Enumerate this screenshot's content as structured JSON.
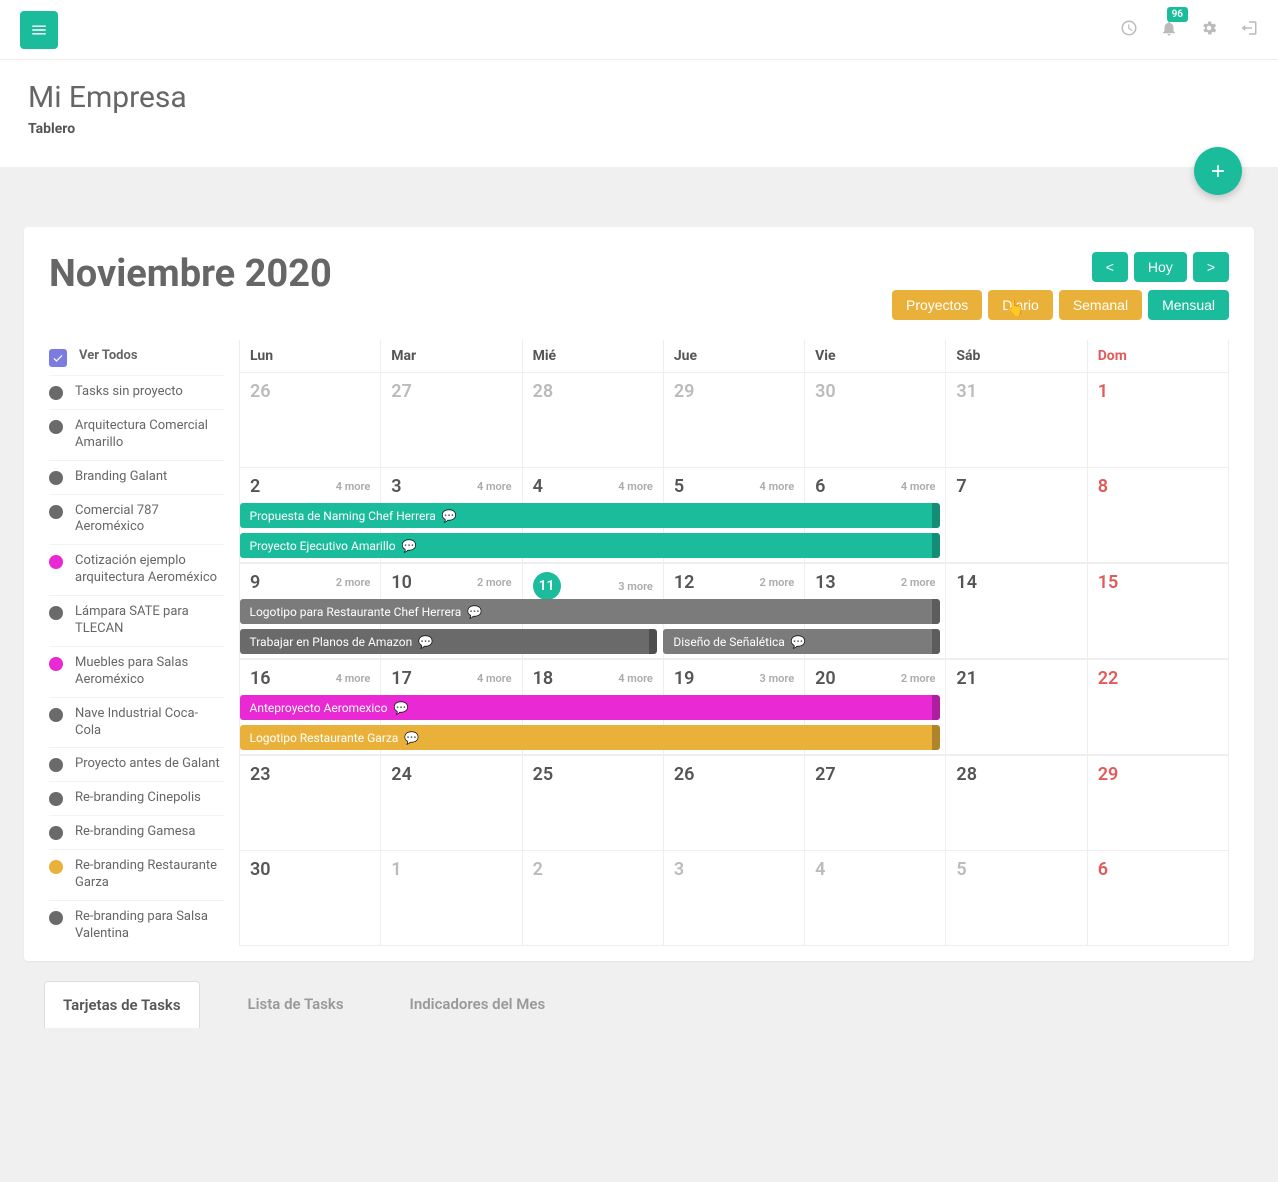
{
  "topbar": {
    "badge": "96"
  },
  "header": {
    "title": "Mi Empresa",
    "subtitle": "Tablero"
  },
  "calendar": {
    "title": "Noviembre 2020",
    "nav": {
      "prev": "<",
      "today": "Hoy",
      "next": ">"
    },
    "views": {
      "projects": "Proyectos",
      "daily": "Diario",
      "weekly": "Semanal",
      "monthly": "Mensual"
    },
    "days": [
      "Lun",
      "Mar",
      "Mié",
      "Jue",
      "Vie",
      "Sáb",
      "Dom"
    ]
  },
  "filters": {
    "all": "Ver Todos",
    "items": [
      {
        "label": "Tasks sin proyecto",
        "color": "#6a6a6a"
      },
      {
        "label": "Arquitectura Comercial Amarillo",
        "color": "#6a6a6a"
      },
      {
        "label": "Branding Galant",
        "color": "#6a6a6a"
      },
      {
        "label": "Comercial 787 Aeroméxico",
        "color": "#6a6a6a"
      },
      {
        "label": "Cotización ejemplo arquitectura Aeroméxico",
        "color": "#e929d3"
      },
      {
        "label": "Lámpara SATE para TLECAN",
        "color": "#6a6a6a"
      },
      {
        "label": "Muebles para Salas Aeroméxico",
        "color": "#e929d3"
      },
      {
        "label": "Nave Industrial Coca-Cola",
        "color": "#6a6a6a"
      },
      {
        "label": "Proyecto antes de Galant",
        "color": "#6a6a6a"
      },
      {
        "label": "Re-branding Cinepolis",
        "color": "#6a6a6a"
      },
      {
        "label": "Re-branding Gamesa",
        "color": "#6a6a6a"
      },
      {
        "label": "Re-branding Restaurante Garza",
        "color": "#eab13a"
      },
      {
        "label": "Re-branding para Salsa Valentina",
        "color": "#6a6a6a"
      }
    ]
  },
  "weeks": [
    [
      {
        "n": "26",
        "muted": true
      },
      {
        "n": "27",
        "muted": true
      },
      {
        "n": "28",
        "muted": true
      },
      {
        "n": "29",
        "muted": true
      },
      {
        "n": "30",
        "muted": true
      },
      {
        "n": "31",
        "muted": true
      },
      {
        "n": "1",
        "sun": true
      }
    ],
    [
      {
        "n": "2",
        "more": "4 more"
      },
      {
        "n": "3",
        "more": "4 more"
      },
      {
        "n": "4",
        "more": "4 more"
      },
      {
        "n": "5",
        "more": "4 more"
      },
      {
        "n": "6",
        "more": "4 more"
      },
      {
        "n": "7"
      },
      {
        "n": "8",
        "sun": true
      }
    ],
    [
      {
        "n": "9",
        "more": "2 more"
      },
      {
        "n": "10",
        "more": "2 more"
      },
      {
        "n": "11",
        "more": "3 more",
        "today": true
      },
      {
        "n": "12",
        "more": "2 more"
      },
      {
        "n": "13",
        "more": "2 more"
      },
      {
        "n": "14"
      },
      {
        "n": "15",
        "sun": true
      }
    ],
    [
      {
        "n": "16",
        "more": "4 more"
      },
      {
        "n": "17",
        "more": "4 more"
      },
      {
        "n": "18",
        "more": "4 more"
      },
      {
        "n": "19",
        "more": "3 more"
      },
      {
        "n": "20",
        "more": "2 more"
      },
      {
        "n": "21"
      },
      {
        "n": "22",
        "sun": true
      }
    ],
    [
      {
        "n": "23"
      },
      {
        "n": "24"
      },
      {
        "n": "25"
      },
      {
        "n": "26"
      },
      {
        "n": "27"
      },
      {
        "n": "28"
      },
      {
        "n": "29",
        "sun": true
      }
    ],
    [
      {
        "n": "30"
      },
      {
        "n": "1",
        "muted": true
      },
      {
        "n": "2",
        "muted": true
      },
      {
        "n": "3",
        "muted": true
      },
      {
        "n": "4",
        "muted": true
      },
      {
        "n": "5",
        "muted": true
      },
      {
        "n": "6",
        "muted": true,
        "sun": true
      }
    ]
  ],
  "events": {
    "w1": [
      {
        "label": "Propuesta de Naming Chef Herrera",
        "cls": "ev-teal",
        "span": 5
      },
      {
        "label": "Proyecto Ejecutivo Amarillo",
        "cls": "ev-teal",
        "span": 5
      }
    ],
    "w2": [
      {
        "label": "Logotipo para Restaurante Chef Herrera",
        "cls": "ev-grey",
        "span": 5
      },
      {
        "label": "Trabajar en Planos de Amazon",
        "cls": "ev-grey2",
        "span": 3
      },
      {
        "label": "Diseño de Señalética",
        "cls": "ev-grey",
        "start": 3,
        "span": 2
      }
    ],
    "w3": [
      {
        "label": "Anteproyecto Aeromexico",
        "cls": "ev-pink",
        "span": 5
      },
      {
        "label": "Logotipo Restaurante Garza",
        "cls": "ev-yellow",
        "span": 5
      }
    ]
  },
  "tabs": {
    "cards": "Tarjetas de Tasks",
    "list": "Lista de Tasks",
    "indicators": "Indicadores del Mes"
  }
}
